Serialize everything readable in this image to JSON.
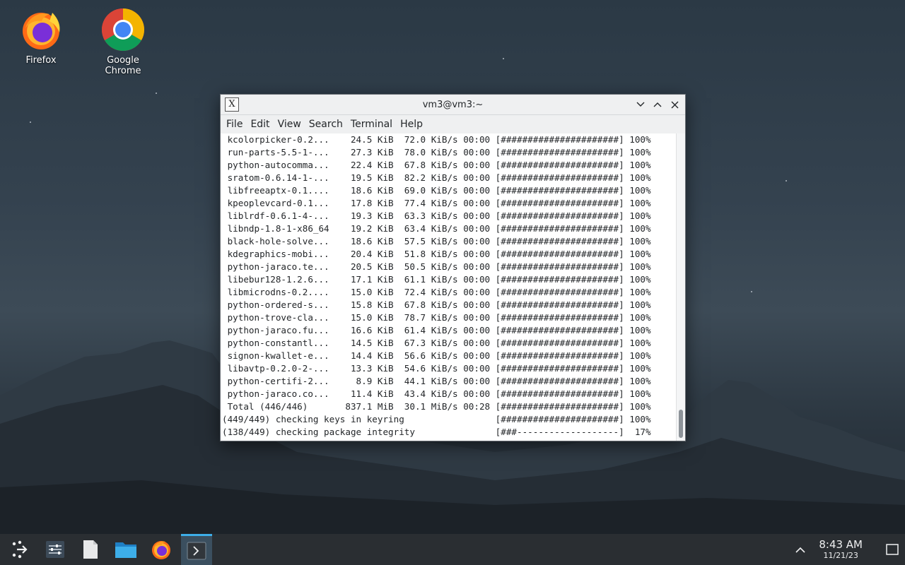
{
  "desktop_icons": [
    {
      "label": "Firefox",
      "icon": "firefox-icon"
    },
    {
      "label": "Google Chrome",
      "icon": "chrome-icon"
    }
  ],
  "window": {
    "title": "vm3@vm3:~",
    "menu": [
      "File",
      "Edit",
      "View",
      "Search",
      "Terminal",
      "Help"
    ]
  },
  "terminal_lines": [
    " kcolorpicker-0.2...    24.5 KiB  72.0 KiB/s 00:00 [######################] 100%",
    " run-parts-5.5-1-...    27.3 KiB  78.0 KiB/s 00:00 [######################] 100%",
    " python-autocomma...    22.4 KiB  67.8 KiB/s 00:00 [######################] 100%",
    " sratom-0.6.14-1-...    19.5 KiB  82.2 KiB/s 00:00 [######################] 100%",
    " libfreeaptx-0.1....    18.6 KiB  69.0 KiB/s 00:00 [######################] 100%",
    " kpeoplevcard-0.1...    17.8 KiB  77.4 KiB/s 00:00 [######################] 100%",
    " liblrdf-0.6.1-4-...    19.3 KiB  63.3 KiB/s 00:00 [######################] 100%",
    " libndp-1.8-1-x86_64    19.2 KiB  63.4 KiB/s 00:00 [######################] 100%",
    " black-hole-solve...    18.6 KiB  57.5 KiB/s 00:00 [######################] 100%",
    " kdegraphics-mobi...    20.4 KiB  51.8 KiB/s 00:00 [######################] 100%",
    " python-jaraco.te...    20.5 KiB  50.5 KiB/s 00:00 [######################] 100%",
    " libebur128-1.2.6...    17.1 KiB  61.1 KiB/s 00:00 [######################] 100%",
    " libmicrodns-0.2....    15.0 KiB  72.4 KiB/s 00:00 [######################] 100%",
    " python-ordered-s...    15.8 KiB  67.8 KiB/s 00:00 [######################] 100%",
    " python-trove-cla...    15.0 KiB  78.7 KiB/s 00:00 [######################] 100%",
    " python-jaraco.fu...    16.6 KiB  61.4 KiB/s 00:00 [######################] 100%",
    " python-constantl...    14.5 KiB  67.3 KiB/s 00:00 [######################] 100%",
    " signon-kwallet-e...    14.4 KiB  56.6 KiB/s 00:00 [######################] 100%",
    " libavtp-0.2.0-2-...    13.3 KiB  54.6 KiB/s 00:00 [######################] 100%",
    " python-certifi-2...     8.9 KiB  44.1 KiB/s 00:00 [######################] 100%",
    " python-jaraco.co...    11.4 KiB  43.4 KiB/s 00:00 [######################] 100%",
    " Total (446/446)       837.1 MiB  30.1 MiB/s 00:28 [######################] 100%",
    "(449/449) checking keys in keyring                 [######################] 100%",
    "(138/449) checking package integrity               [###-------------------]  17%"
  ],
  "taskbar": {
    "items": [
      {
        "name": "application-launcher",
        "icon": "launcher-icon"
      },
      {
        "name": "system-settings",
        "icon": "settings-sliders-icon"
      },
      {
        "name": "text-editor",
        "icon": "document-icon"
      },
      {
        "name": "file-manager",
        "icon": "folder-icon"
      },
      {
        "name": "firefox",
        "icon": "firefox-icon"
      },
      {
        "name": "terminal",
        "icon": "terminal-icon",
        "active": true
      }
    ],
    "clock_time": "8:43 AM",
    "clock_date": "11/21/23"
  },
  "colors": {
    "accent": "#3daee9",
    "taskbar_bg": "#2a2e32",
    "window_chrome": "#eff0f1"
  }
}
